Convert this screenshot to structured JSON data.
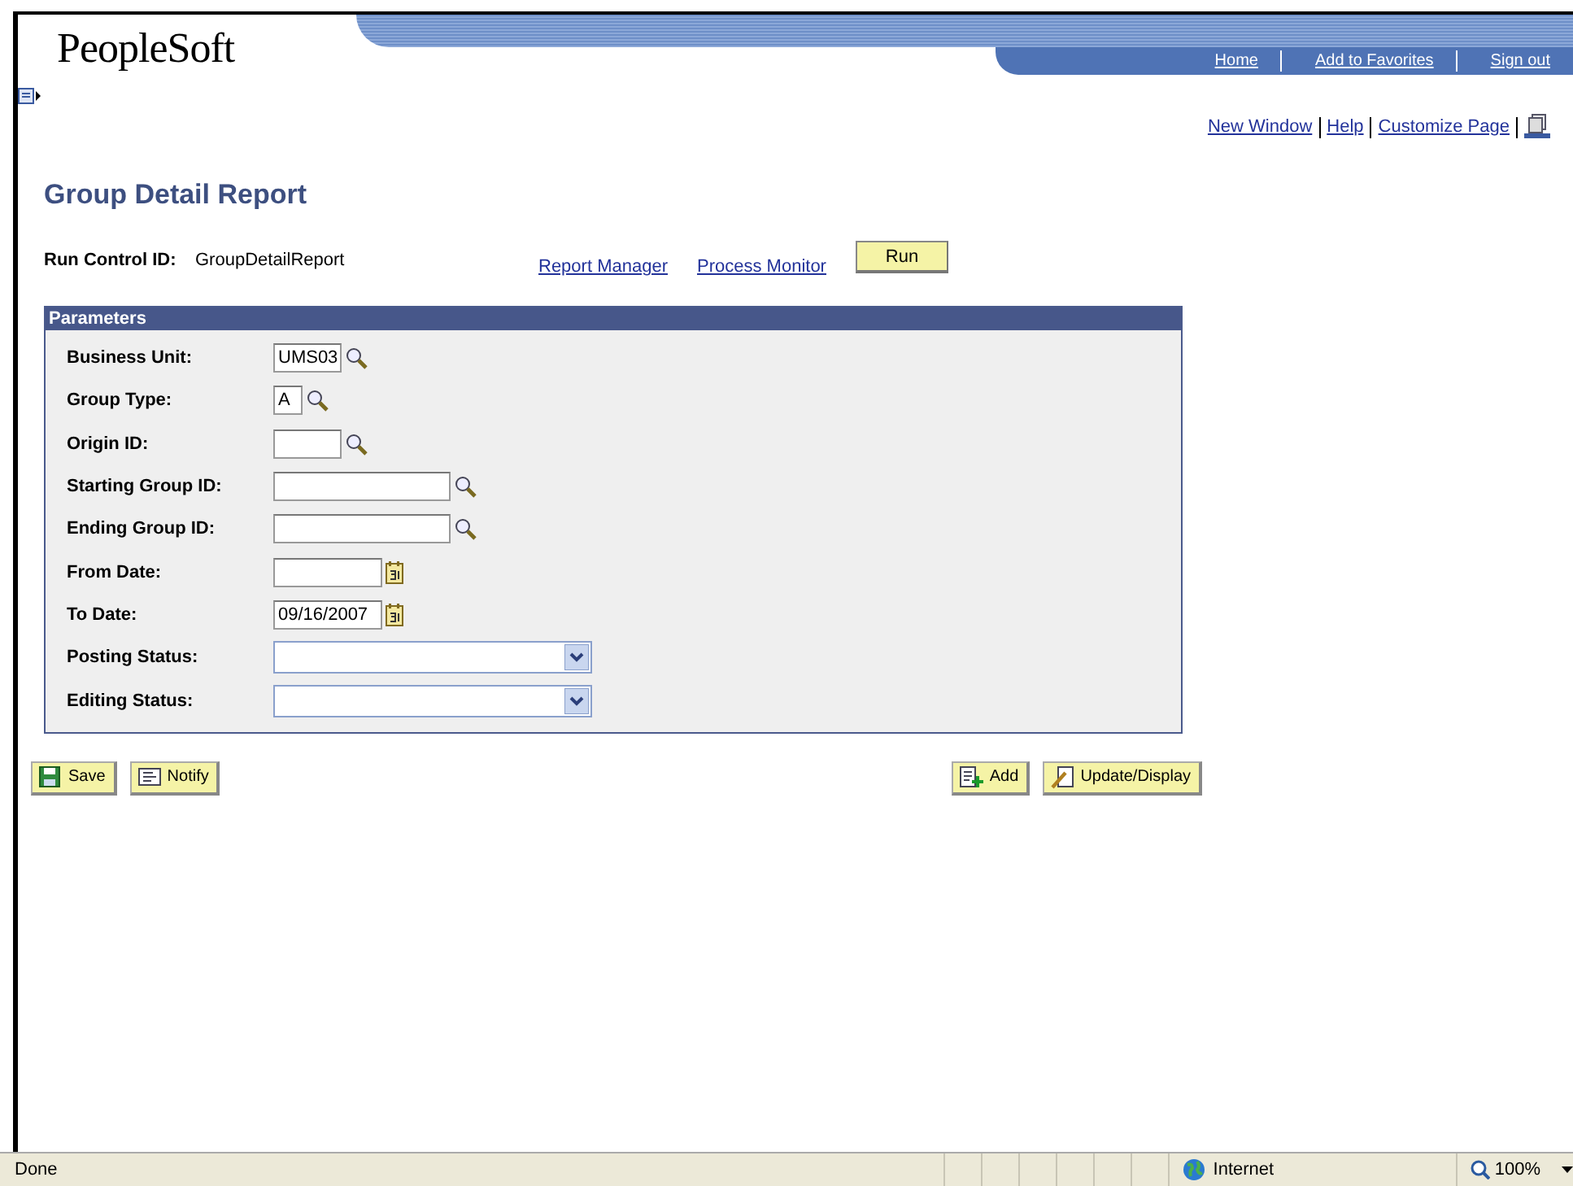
{
  "header": {
    "logo": "PeopleSoft",
    "nav_links": [
      "Home",
      "Add to Favorites",
      "Sign out"
    ]
  },
  "utility_links": [
    "New Window",
    "Help",
    "Customize Page"
  ],
  "page_title": "Group Detail Report",
  "run_control": {
    "label": "Run Control ID:",
    "value": "GroupDetailReport",
    "links": [
      "Report Manager",
      "Process Monitor"
    ],
    "run_button": "Run"
  },
  "parameters": {
    "title": "Parameters",
    "fields": [
      {
        "label": "Business Unit:",
        "kind": "lookup",
        "value": "UMS03"
      },
      {
        "label": "Group Type:",
        "kind": "lookup",
        "value": "A"
      },
      {
        "label": "Origin ID:",
        "kind": "lookup"
      },
      {
        "label": "Starting Group ID:",
        "kind": "lookup"
      },
      {
        "label": "Ending Group ID:",
        "kind": "lookup"
      },
      {
        "label": "From Date:",
        "kind": "date"
      },
      {
        "label": "To Date:",
        "kind": "date",
        "value": "09/16/2007"
      },
      {
        "label": "Posting Status:",
        "kind": "dropdown"
      },
      {
        "label": "Editing Status:",
        "kind": "dropdown"
      }
    ]
  },
  "left_buttons": [
    {
      "label": "Save",
      "kind": "save"
    },
    {
      "label": "Notify",
      "kind": "notify"
    }
  ],
  "right_buttons": [
    {
      "label": "Add",
      "kind": "add"
    },
    {
      "label": "Update/Display",
      "kind": "update"
    }
  ],
  "status_bar": {
    "status": "Done",
    "zone": "Internet",
    "zoom": "100%"
  }
}
